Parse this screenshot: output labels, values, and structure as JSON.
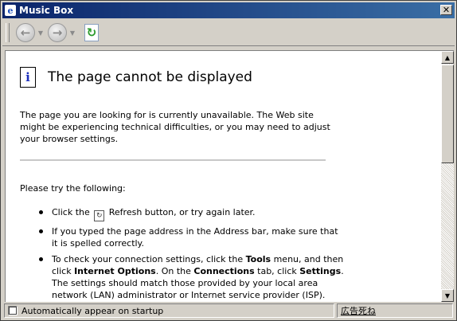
{
  "window": {
    "title": "Music Box",
    "close_glyph": "✕"
  },
  "toolbar": {
    "back_icon": "back-arrow-icon",
    "forward_icon": "forward-arrow-icon",
    "refresh_icon": "refresh-icon"
  },
  "page": {
    "title": "The page cannot be displayed",
    "intro": "The page you are looking for is currently unavailable. The Web site might be experiencing technical difficulties, or you may need to adjust your browser settings.",
    "try_heading": "Please try the following:",
    "items": [
      {
        "before": "Click the",
        "after": "Refresh button, or try again later."
      },
      {
        "text": "If you typed the page address in the Address bar, make sure that it is spelled correctly."
      },
      {
        "t1": "To check your connection settings, click the ",
        "b1": "Tools",
        "t2": " menu, and then click ",
        "b2": "Internet Options",
        "t3": ". On the ",
        "b3": "Connections",
        "t4": " tab, click ",
        "b4": "Settings",
        "t5": ". The settings should match those provided by your local area network (LAN) administrator or Internet service provider (ISP)."
      }
    ]
  },
  "status": {
    "checkbox_label": "Automatically appear on startup",
    "checkbox_checked": false,
    "ad_link": "広告死ね"
  },
  "colors": {
    "title_bar": "#0a246a",
    "chrome": "#d4d0c8",
    "info_icon": "#1c2fbc"
  }
}
